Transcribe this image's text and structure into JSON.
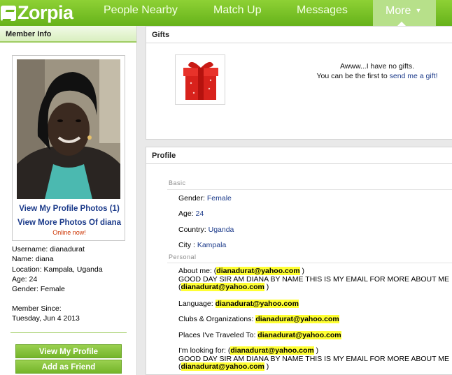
{
  "nav": {
    "logo_text": "Zorpia",
    "items": [
      "People Nearby",
      "Match Up",
      "Messages"
    ],
    "more_label": "More",
    "more_caret": "▼"
  },
  "member_info": {
    "header": "Member Info",
    "view_profile_photos": "View My Profile Photos (1)",
    "view_more_photos": "View More Photos Of diana",
    "online_status": "Online now!",
    "username": "Username: dianadurat",
    "name": "Name: diana",
    "location": "Location: Kampala, Uganda",
    "age": "Age: 24",
    "gender": "Gender: Female",
    "member_since_label": "Member Since:",
    "member_since_date": "Tuesday, Jun 4 2013",
    "view_my_profile_button": "View My Profile",
    "add_as_friend_button": "Add as Friend"
  },
  "gifts": {
    "header": "Gifts",
    "empty_line1": "Awww...I have no gifts.",
    "empty_line2_prefix": "You can be the first to",
    "send_gift_link": "send me a gift!"
  },
  "profile": {
    "header": "Profile",
    "basic_label": "Basic",
    "gender_label": "Gender:",
    "gender_value": "Female",
    "age_label": "Age:",
    "age_value": "24",
    "country_label": "Country:",
    "country_value": "Uganda",
    "city_label": "City :",
    "city_value": "Kampala",
    "personal_label": "Personal",
    "about_label": "About me:",
    "email": "dianadurat@yahoo.com",
    "about_text": "GOOD DAY SIR AM DIANA BY NAME THIS IS MY EMAIL FOR MORE ABOUT ME",
    "language_label": "Language:",
    "clubs_label": "Clubs & Organizations:",
    "places_label": "Places I've Traveled To:",
    "looking_label": "I'm looking for:",
    "looking_text": "GOOD DAY SIR AM DIANA BY NAME THIS IS MY EMAIL FOR MORE ABOUT ME"
  },
  "colors": {
    "brand_green": "#74b52a",
    "link_blue": "#1b3a8a",
    "highlight": "#ffff33"
  }
}
